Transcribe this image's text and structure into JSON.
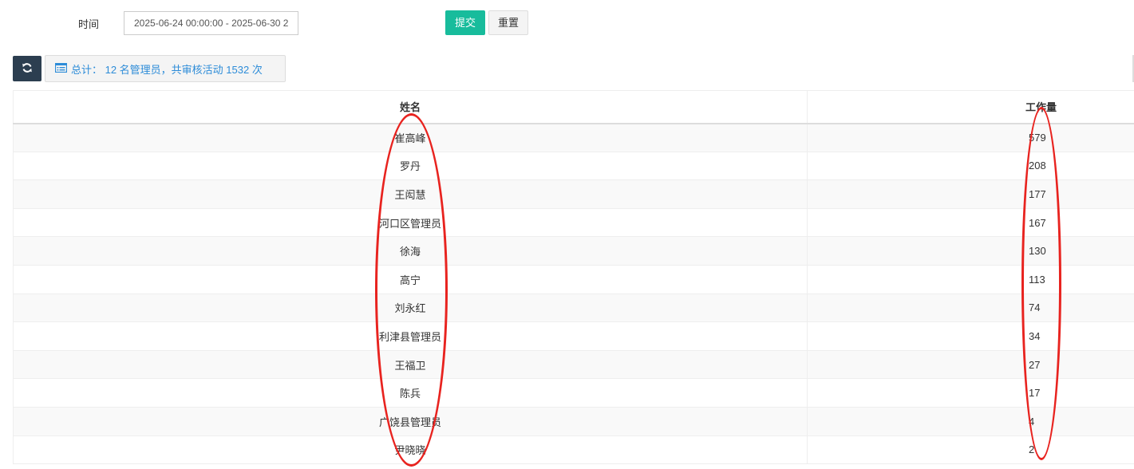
{
  "filter": {
    "time_label": "时间",
    "date_range_value": "2025-06-24 00:00:00 - 2025-06-30 2",
    "submit_label": "提交",
    "reset_label": "重置"
  },
  "toolbar": {
    "refresh_icon": "refresh-icon",
    "summary_icon": "list-icon",
    "summary_text": "总计： 12 名管理员，共审核活动 1532 次"
  },
  "table": {
    "headers": {
      "name": "姓名",
      "workload": "工作量"
    },
    "rows": [
      {
        "name": "崔高峰",
        "workload": "579"
      },
      {
        "name": "罗丹",
        "workload": "208"
      },
      {
        "name": "王闳慧",
        "workload": "177"
      },
      {
        "name": "河口区管理员",
        "workload": "167"
      },
      {
        "name": "徐海",
        "workload": "130"
      },
      {
        "name": "高宁",
        "workload": "113"
      },
      {
        "name": "刘永红",
        "workload": "74"
      },
      {
        "name": "利津县管理员",
        "workload": "34"
      },
      {
        "name": "王福卫",
        "workload": "27"
      },
      {
        "name": "陈兵",
        "workload": "17"
      },
      {
        "name": "广饶县管理员",
        "workload": "4"
      },
      {
        "name": "尹晓晓",
        "workload": "2"
      }
    ]
  },
  "colors": {
    "primary": "#18bc9c",
    "dark": "#2c3e50",
    "link": "#2d8cd8",
    "annotation": "#e8231f"
  }
}
